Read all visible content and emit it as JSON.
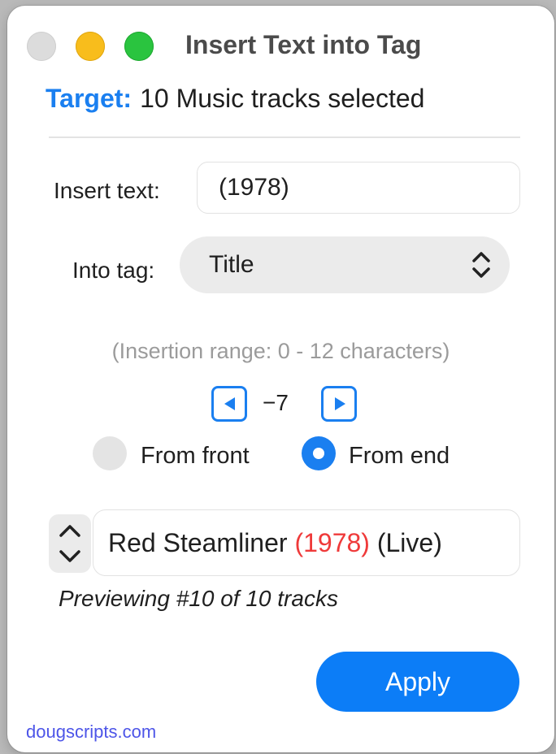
{
  "window": {
    "title": "Insert Text into Tag"
  },
  "target": {
    "label": "Target:",
    "value": "10 Music tracks selected"
  },
  "insert": {
    "label": "Insert text:",
    "value": "(1978)"
  },
  "tag": {
    "label": "Into tag:",
    "selected": "Title"
  },
  "range": {
    "note": "(Insertion range: 0 - 12 characters)"
  },
  "offset": {
    "value": "−7"
  },
  "position": {
    "front_label": "From front",
    "end_label": "From end",
    "selected": "From end"
  },
  "preview": {
    "before": "Red Steamliner ",
    "inserted": "(1978)",
    "after": " (Live)",
    "status": "Previewing #10 of 10 tracks"
  },
  "actions": {
    "apply_label": "Apply"
  },
  "footer": {
    "link": "dougscripts.com"
  },
  "colors": {
    "accent": "#1a7ff0",
    "apply_button": "#0c7df7",
    "inserted_text": "#ef3a3a",
    "footer_link": "#4d55e8"
  },
  "icons": {
    "popup": "chevron-up-down-icon",
    "offset_left": "triangle-left-icon",
    "offset_right": "triangle-right-icon",
    "preview_stepper": "chevron-up-down-icon"
  }
}
